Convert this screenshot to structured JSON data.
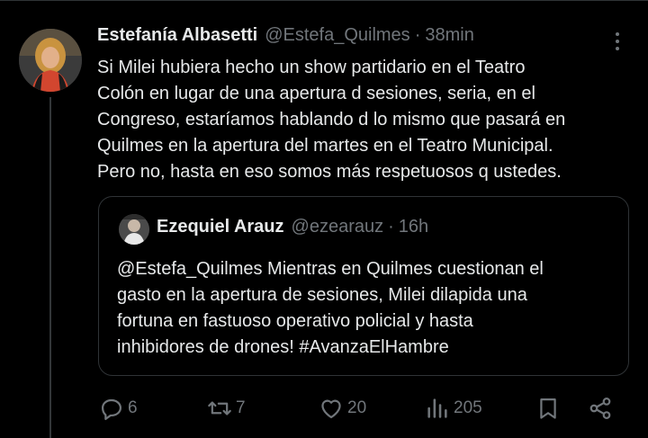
{
  "tweet": {
    "author_name": "Estefanía Albasetti",
    "handle": "@Estefa_Quilmes",
    "separator": "·",
    "time": "38min",
    "text_lines": [
      "Si Milei hubiera hecho un show partidario en el Teatro",
      "Colón en lugar de una apertura d sesiones, seria, en el",
      "Congreso, estaríamos hablando d lo mismo que pasará en",
      "Quilmes en la apertura del martes en el Teatro Municipal.",
      "Pero no, hasta en eso somos más respetuosos q ustedes."
    ]
  },
  "quote": {
    "author_name": "Ezequiel Arauz",
    "handle": "@ezearauz",
    "separator": "·",
    "time": "16h",
    "text_lines": [
      "@Estefa_Quilmes Mientras en Quilmes cuestionan el",
      "gasto en la apertura de sesiones, Milei dilapida una",
      "fortuna en fastuoso operativo policial y hasta",
      "inhibidores de drones! #AvanzaElHambre"
    ]
  },
  "actions": {
    "replies": "6",
    "retweets": "7",
    "likes": "20",
    "views": "205"
  },
  "colors": {
    "background": "#000000",
    "text": "#e7e9ea",
    "secondary": "#71767b",
    "border": "#2f3336"
  },
  "icons": {
    "reply": "reply-icon",
    "retweet": "retweet-icon",
    "like": "heart-icon",
    "views": "analytics-icon",
    "bookmark": "bookmark-icon",
    "share": "share-icon",
    "more": "more-icon"
  }
}
